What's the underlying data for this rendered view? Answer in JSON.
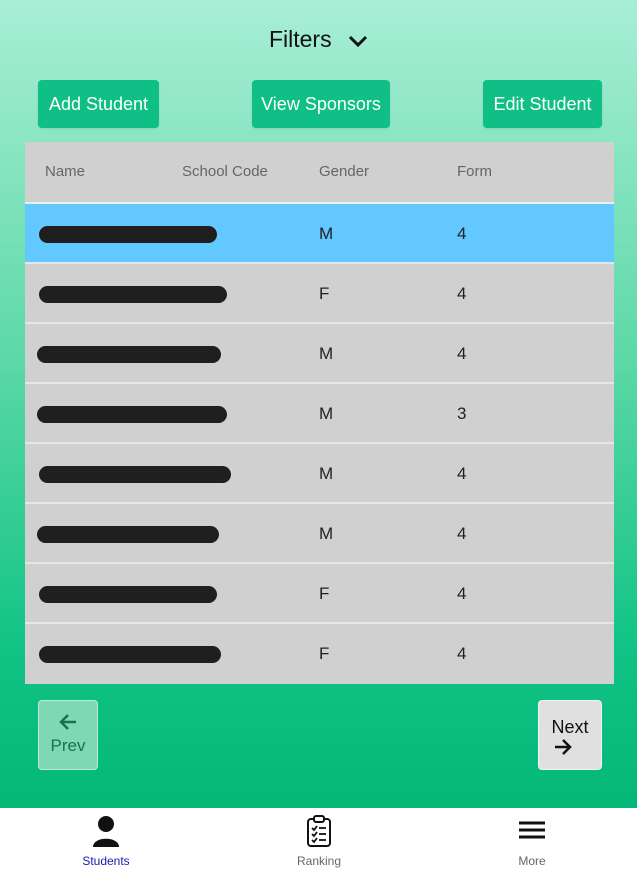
{
  "header": {
    "filters_label": "Filters"
  },
  "actions": {
    "add_student": "Add Student",
    "view_sponsors": "View Sponsors",
    "edit_student": "Edit Student"
  },
  "table": {
    "columns": [
      "Name",
      "School Code",
      "Gender",
      "Form"
    ],
    "rows": [
      {
        "gender": "M",
        "form": "4"
      },
      {
        "gender": "F",
        "form": "4"
      },
      {
        "gender": "M",
        "form": "4"
      },
      {
        "gender": "M",
        "form": "3"
      },
      {
        "gender": "M",
        "form": "4"
      },
      {
        "gender": "M",
        "form": "4"
      },
      {
        "gender": "F",
        "form": "4"
      },
      {
        "gender": "F",
        "form": "4"
      }
    ]
  },
  "pagination": {
    "prev_label": "Prev",
    "next_label": "Next"
  },
  "tabbar": {
    "students": "Students",
    "ranking": "Ranking",
    "more": "More"
  },
  "colors": {
    "accent": "#0fbf86",
    "selected_row": "#62c8ff",
    "active_tab": "#1a1ab0"
  },
  "icons": {
    "filters": "chevron-down-icon",
    "students": "person-icon",
    "ranking": "clipboard-icon",
    "more": "menu-icon",
    "prev": "arrow-left-icon",
    "next": "arrow-right-icon"
  }
}
